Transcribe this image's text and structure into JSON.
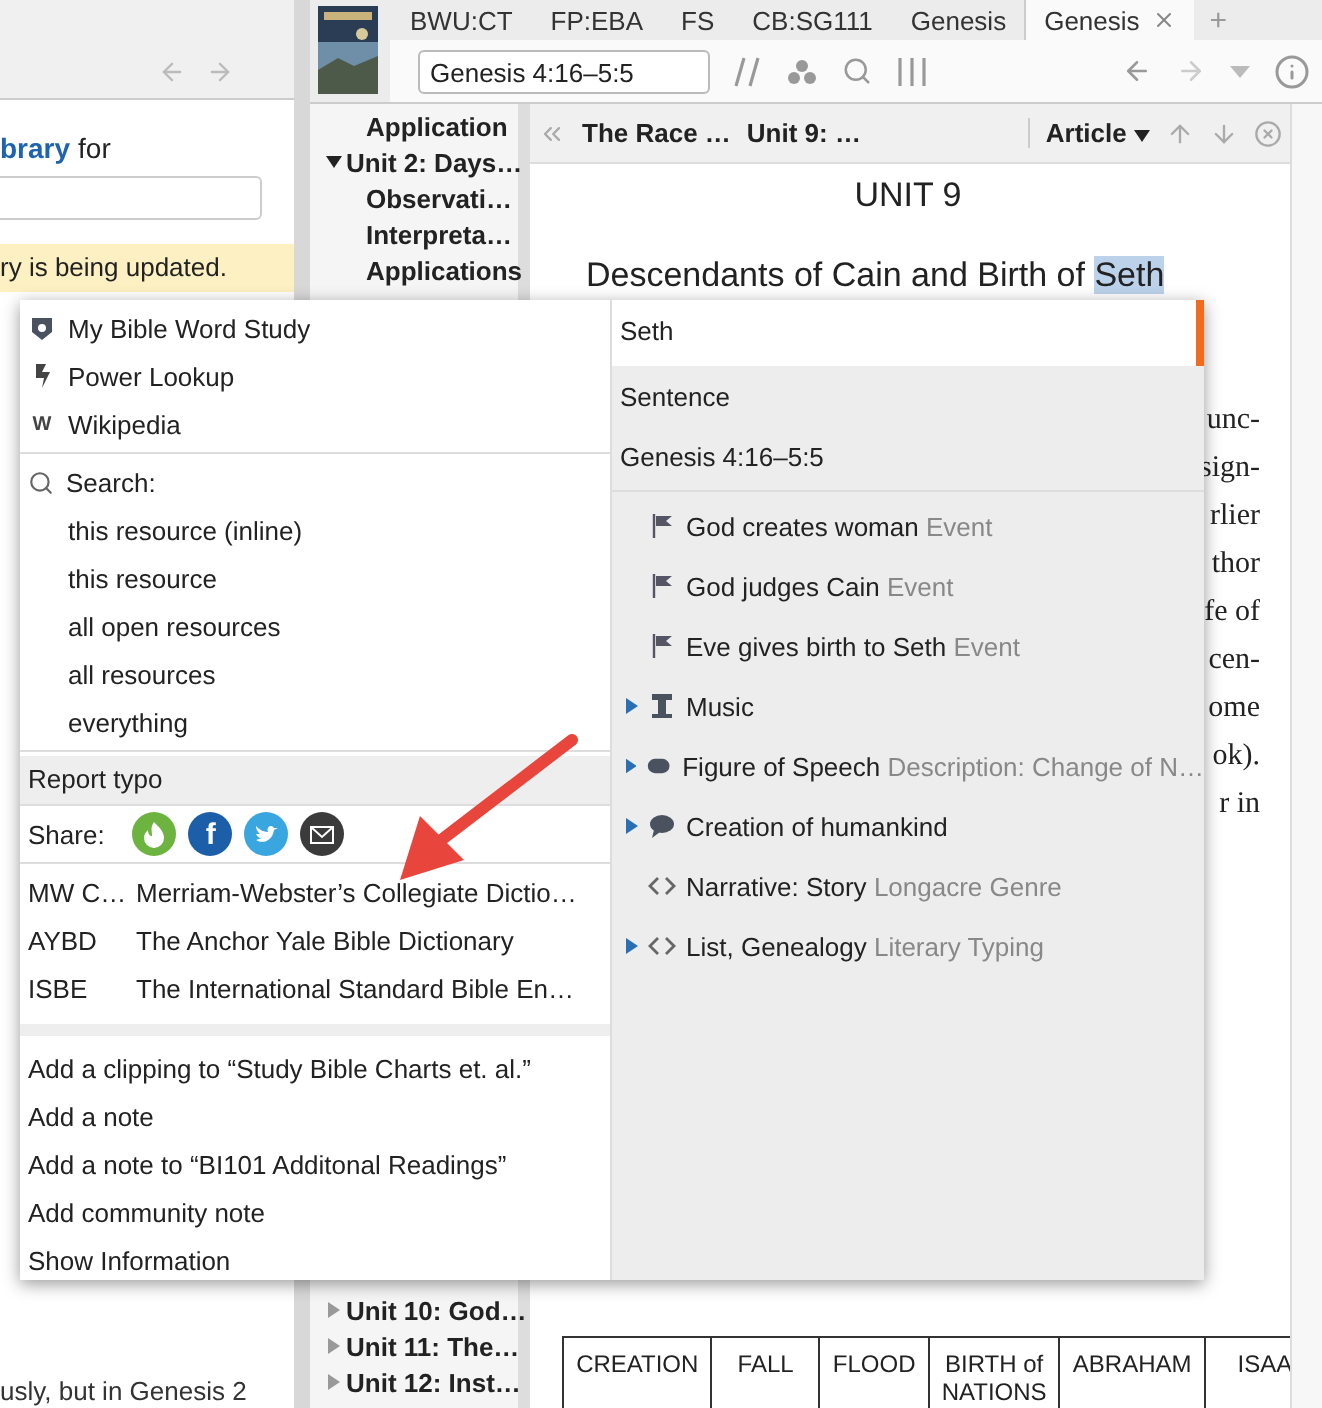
{
  "left_pane": {
    "link": "brary",
    "text": "for",
    "banner": "ry is being updated.",
    "footer_text": "usly, but in Genesis 2"
  },
  "tabs": [
    {
      "label": "BWU:CT",
      "selected": false
    },
    {
      "label": "FP:EBA",
      "selected": false
    },
    {
      "label": "FS",
      "selected": false
    },
    {
      "label": "CB:SG111",
      "selected": false
    },
    {
      "label": "Genesis",
      "selected": false
    },
    {
      "label": "Genesis",
      "selected": true
    }
  ],
  "new_tab": "+",
  "reference": "Genesis 4:16–5:5",
  "outline_top": [
    {
      "label": "Application",
      "kind": "leaf"
    },
    {
      "label": "Unit 2: Days…",
      "kind": "node",
      "expanded": true
    },
    {
      "label": "Observati…",
      "kind": "leaf"
    },
    {
      "label": "Interpreta…",
      "kind": "leaf"
    },
    {
      "label": "Applications",
      "kind": "leaf"
    }
  ],
  "outline_bottom": [
    {
      "label": "Unit 10: God…",
      "kind": "node",
      "expanded": false
    },
    {
      "label": "Unit 11: The…",
      "kind": "node",
      "expanded": false
    },
    {
      "label": "Unit 12: Inst…",
      "kind": "node",
      "expanded": false
    }
  ],
  "breadcrumb": [
    "The Race …",
    "Unit 9: …"
  ],
  "view_menu": "Article",
  "article": {
    "title": "UNIT 9",
    "heading": "Descendants of Cain and Birth of ",
    "highlight": "Seth",
    "line_ends": [
      "unc-",
      "sign-",
      "rlier",
      "thor",
      "fe of",
      "cen-",
      "ome",
      "ok).",
      "r in"
    ],
    "table_headers": [
      "CREATION",
      "FALL",
      "FLOOD",
      "BIRTH of NATIONS",
      "ABRAHAM",
      "ISAA"
    ]
  },
  "popup": {
    "quick": [
      {
        "label": "My Bible Word Study",
        "kind": "shield"
      },
      {
        "label": "Power Lookup",
        "kind": "bolt"
      },
      {
        "label": "Wikipedia",
        "kind": "letter",
        "glyph": "W"
      }
    ],
    "search_label": "Search:",
    "search_items": [
      "this resource (inline)",
      "this resource",
      "all open resources",
      "all resources",
      "everything"
    ],
    "report": {
      "label": "Report typo",
      "selected": true
    },
    "share_label": "Share:",
    "share": [
      {
        "kind": "flame"
      },
      {
        "kind": "letter",
        "glyph": "f",
        "color": "#1d5ea8"
      },
      {
        "kind": "bird",
        "color": "#3aa6e0"
      },
      {
        "kind": "envelope",
        "color": "#3b3b3b"
      }
    ],
    "resources": [
      {
        "abbr": "MW C…",
        "title": "Merriam-Webster’s Collegiate Dictio…"
      },
      {
        "abbr": "AYBD",
        "title": "The Anchor Yale Bible Dictionary"
      },
      {
        "abbr": "ISBE",
        "title": "The International Standard Bible En…"
      }
    ],
    "actions": [
      "Add a clipping to “Study Bible Charts et. al.”",
      "Add a note",
      "Add a note to “BI101 Additonal Readings”",
      "Add community note",
      "Show Information"
    ],
    "headers": [
      {
        "label": "Seth",
        "selected": true
      },
      {
        "label": "Sentence",
        "selected": false
      },
      {
        "label": "Genesis 4:16–5:5",
        "selected": false
      }
    ],
    "items": [
      {
        "label": "God creates woman",
        "type": "Event",
        "kind": "flag",
        "expandable": false
      },
      {
        "label": "God judges Cain",
        "type": "Event",
        "kind": "flag",
        "expandable": false
      },
      {
        "label": "Eve gives birth to Seth",
        "type": "Event",
        "kind": "flag",
        "expandable": false
      },
      {
        "label": "Music",
        "kind": "column",
        "expandable": true
      },
      {
        "label": "Figure of Speech",
        "type": "Description: Change of N…",
        "kind": "tag",
        "expandable": true
      },
      {
        "label": "Creation of humankind",
        "kind": "bubble",
        "expandable": true
      },
      {
        "label": "Narrative: Story",
        "type": "Longacre Genre",
        "kind": "brackets",
        "expandable": false
      },
      {
        "label": "List, Genealogy",
        "type": "Literary Typing",
        "kind": "brackets",
        "expandable": true
      }
    ]
  }
}
